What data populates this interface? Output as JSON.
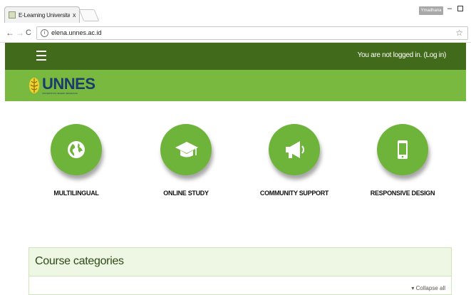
{
  "browser": {
    "tab_title": "E-Learning Universitas N",
    "tab_close": "x",
    "profile_label": "Ymadhana",
    "url": "elena.unnes.ac.id",
    "window_min": "–"
  },
  "navbar": {
    "login_text": "You are not logged in. (Log in)"
  },
  "logo": {
    "name": "UNNES",
    "subtitle": "UNIVERSITAS NEGERI SEMARANG"
  },
  "features": [
    {
      "label": "MULTILINGUAL",
      "icon": "globe-icon"
    },
    {
      "label": "ONLINE STUDY",
      "icon": "graduation-cap-icon"
    },
    {
      "label": "COMMUNITY SUPPORT",
      "icon": "megaphone-icon"
    },
    {
      "label": "RESPONSIVE DESIGN",
      "icon": "mobile-phone-icon"
    }
  ],
  "categories": {
    "title": "Course categories",
    "collapse_label": "▾ Collapse all"
  },
  "colors": {
    "navbar": "#426a1b",
    "header_band": "#7ab93f",
    "circle": "#6fb43a",
    "logo_text": "#193c6a",
    "categories_header": "#eef7e3"
  }
}
